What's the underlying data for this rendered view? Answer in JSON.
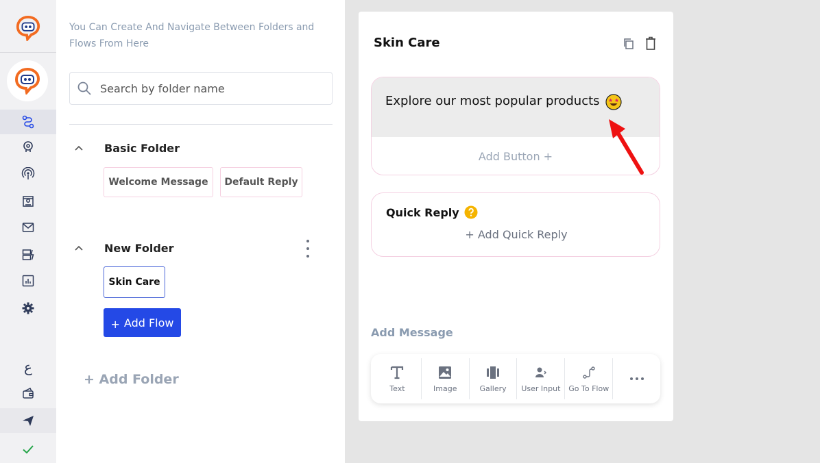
{
  "sidebar": {
    "items": [
      "flows-icon",
      "bot-settings-icon",
      "broadcast-icon",
      "contacts-icon",
      "mail-icon",
      "templates-icon",
      "analytics-icon",
      "settings-icon",
      "language-icon",
      "wallet-icon",
      "send-icon",
      "check-icon"
    ],
    "language_glyph": "ع"
  },
  "panel": {
    "hint": "You Can Create And Navigate Between Folders and Flows From Here",
    "search_placeholder": "Search by folder name",
    "folders": [
      {
        "name": "Basic Folder",
        "flows": [
          "Welcome Message",
          "Default Reply"
        ]
      },
      {
        "name": "New Folder",
        "flows": [
          "Skin Care"
        ]
      }
    ],
    "add_flow": "Add Flow",
    "add_flow_plus": "+",
    "add_folder": "+ Add Folder"
  },
  "flow": {
    "title": "Skin Care",
    "message_text": "Explore our most popular products",
    "add_button": "Add Button +",
    "quick_reply_title": "Quick Reply",
    "add_quick_reply": "+ Add Quick Reply",
    "add_message_label": "Add Message",
    "tools": [
      "Text",
      "Image",
      "Gallery",
      "User Input",
      "Go To Flow"
    ]
  },
  "colors": {
    "brand_orange": "#f26b21",
    "primary_blue": "#2449e6",
    "annotation_red": "#ee1111"
  }
}
